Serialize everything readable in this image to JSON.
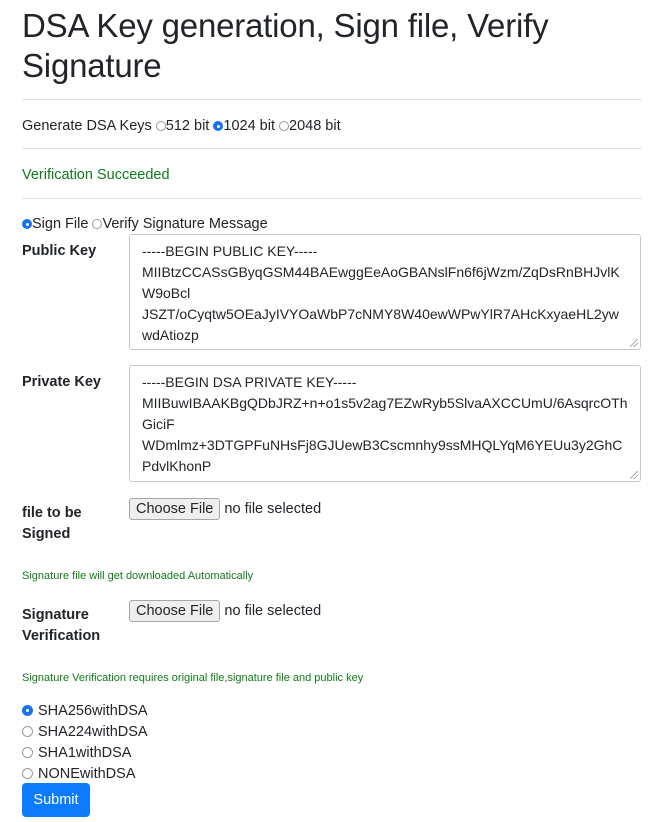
{
  "title": "DSA Key generation, Sign file, Verify Signature",
  "generate": {
    "label": "Generate DSA Keys",
    "options": [
      {
        "label": "512 bit",
        "checked": false
      },
      {
        "label": "1024 bit",
        "checked": true
      },
      {
        "label": "2048 bit",
        "checked": false
      }
    ]
  },
  "status": "Verification Succeeded",
  "mode": {
    "options": [
      {
        "label": "Sign File",
        "checked": true
      },
      {
        "label": "Verify Signature Message",
        "checked": false
      }
    ]
  },
  "public_key": {
    "label": "Public Key",
    "lines": [
      "-----BEGIN PUBLIC KEY-----",
      "MIIBtzCCASsGByqGSM44BAEwggEeAoGBANslFn6f6jWzm/ZqDsRnBHJvlK",
      "W9oBcl",
      "JSZT/oCyqtw5OEaJyIVYOaWbP7cNMY8W40ewWPwYlR7AHcKxyaeHL2yw",
      "wdAtiozp"
    ]
  },
  "private_key": {
    "label": "Private Key",
    "lines": [
      "-----BEGIN DSA PRIVATE KEY-----",
      "MIIBuwIBAAKBgQDbJRZ+n+o1s5v2ag7EZwRyb5SlvaAXCCUmU/6AsqrcOTh",
      "GiciF",
      "WDmlmz+3DTGPFuNHsFj8GJUewB3Cscmnhy9ssMHQLYqM6YEUu3y2GhC",
      "PdvlKhonP"
    ]
  },
  "sign_file": {
    "label_line1": "file to be",
    "label_line2": "Signed",
    "button": "Choose File",
    "status": "no file selected",
    "note": "Signature file will get downloaded Automatically"
  },
  "verify_file": {
    "label_line1": "Signature",
    "label_line2": "Verification",
    "button": "Choose File",
    "status": "no file selected",
    "note": "Signature Verification requires original file,signature file and public key"
  },
  "algorithms": [
    {
      "label": "SHA256withDSA",
      "checked": true
    },
    {
      "label": "SHA224withDSA",
      "checked": false
    },
    {
      "label": "SHA1withDSA",
      "checked": false
    },
    {
      "label": "NONEwithDSA",
      "checked": false
    }
  ],
  "submit": "Submit"
}
